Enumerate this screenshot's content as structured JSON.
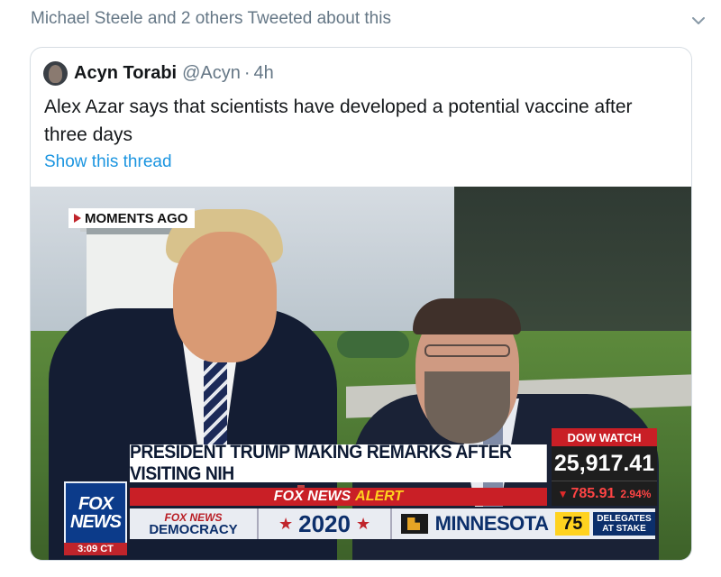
{
  "context": {
    "text": "Michael Steele and 2 others Tweeted about this"
  },
  "tweet": {
    "author_name": "Acyn Torabi",
    "handle": "@Acyn",
    "separator": "·",
    "time": "4h",
    "text": "Alex Azar says that scientists have developed a potential vaccine after three days",
    "thread_link": "Show this thread"
  },
  "broadcast": {
    "moments_tag": "MOMENTS AGO",
    "headline": "PRESIDENT TRUMP MAKING REMARKS AFTER VISITING NIH",
    "alert_brand": "FOX NEWS",
    "alert_word": "ALERT",
    "logo_line1": "FOX",
    "logo_line2": "NEWS",
    "clock": "3:09 CT",
    "ticker": {
      "democracy_line1": "FOX NEWS",
      "democracy_line2": "DEMOCRACY",
      "year": "2020",
      "star": "★",
      "state": "MINNESOTA",
      "delegates_count": "75",
      "delegates_line1": "DELEGATES",
      "delegates_line2": "AT STAKE"
    },
    "dow": {
      "label": "DOW WATCH",
      "value": "25,917.41",
      "arrow": "▼",
      "points": "785.91",
      "percent": "2.94%"
    }
  },
  "colors": {
    "link": "#1b95e0",
    "muted": "#657786",
    "fox_red": "#c91f26",
    "fox_blue": "#0c2f6b",
    "fox_yellow": "#ffd21f"
  },
  "icons": {
    "chevron": "chevron-down-icon",
    "avatar": "avatar",
    "play": "play-triangle-icon"
  }
}
